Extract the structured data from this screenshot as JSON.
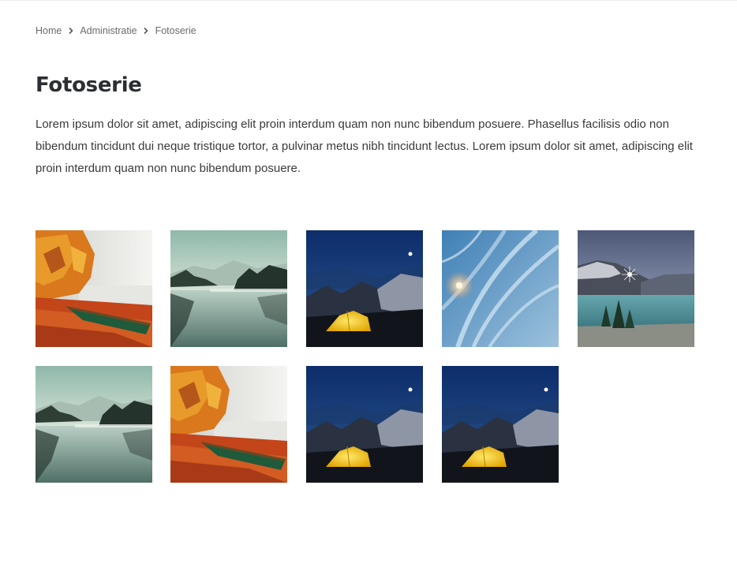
{
  "breadcrumb": {
    "items": [
      {
        "label": "Home"
      },
      {
        "label": "Administratie"
      }
    ],
    "current": "Fotoserie",
    "separator_icon": "chevron-right-icon"
  },
  "page": {
    "title": "Fotoserie",
    "intro": "Lorem ipsum dolor sit amet, adipiscing elit proin interdum quam non nunc bibendum posuere. Phasellus facilisis odio non bibendum tincidunt dui neque tristique tortor, a pulvinar metus nibh tincidunt lectus. Lorem ipsum dolor sit amet, adipiscing elit proin interdum quam non nunc bibendum posuere."
  },
  "gallery": {
    "photos": [
      {
        "subject": "autumn-lake-canoe"
      },
      {
        "subject": "misty-mountain-lake"
      },
      {
        "subject": "tent-under-night-sky"
      },
      {
        "subject": "frost-pattern-sunrise"
      },
      {
        "subject": "mountain-lake-sunstar"
      },
      {
        "subject": "misty-mountain-lake"
      },
      {
        "subject": "autumn-lake-canoe"
      },
      {
        "subject": "tent-under-night-sky"
      },
      {
        "subject": "tent-under-night-sky"
      }
    ]
  },
  "colors": {
    "title": "#2b2f33",
    "body_text": "#3a3a3a",
    "breadcrumb_text": "#6b6b6b"
  }
}
